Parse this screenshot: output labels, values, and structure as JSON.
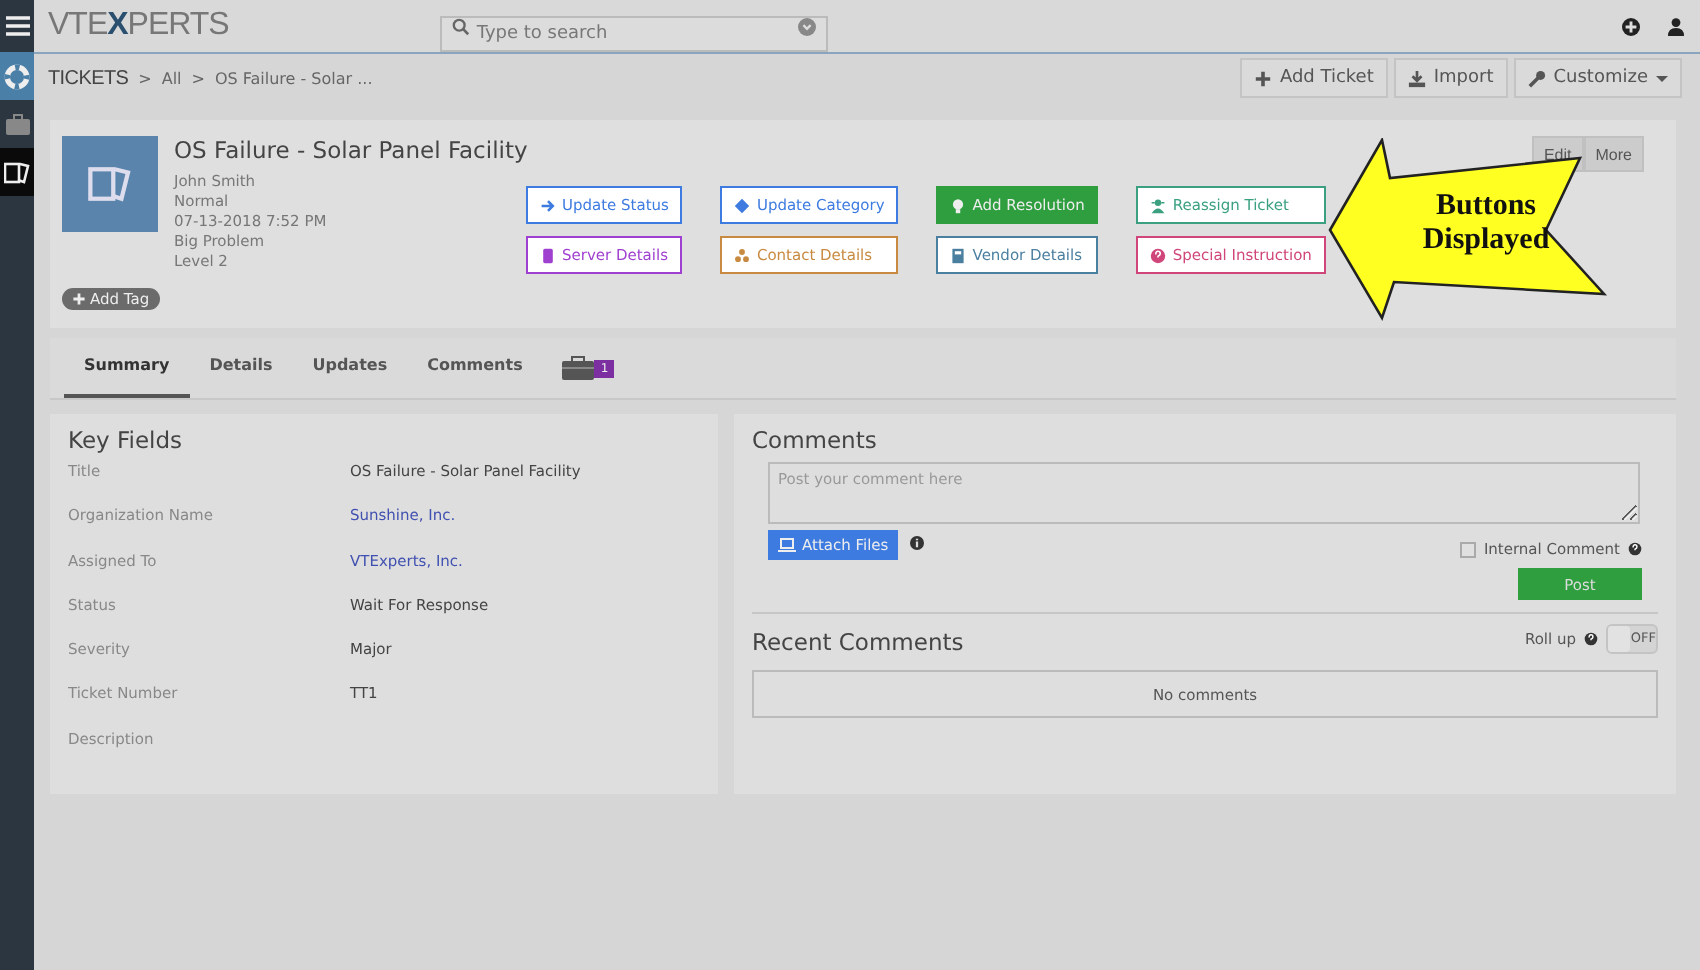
{
  "topbar": {
    "logo": {
      "left": "VTE",
      "mark": "X",
      "right": "PERTS"
    },
    "search": {
      "placeholder": "Type to search"
    }
  },
  "sidebar": {
    "items": [
      {
        "kind": "help"
      },
      {
        "kind": "briefcase"
      },
      {
        "kind": "tickets"
      }
    ]
  },
  "breadcrumb": [
    "TICKETS",
    ">",
    "All",
    ">",
    "OS Failure - Solar ..."
  ],
  "toolbar": [
    {
      "label": "Add Ticket",
      "kind": "plus"
    },
    {
      "label": "Import",
      "kind": "download"
    },
    {
      "label": "Customize",
      "kind": "wrench"
    }
  ],
  "ticket": {
    "title": "OS Failure - Solar Panel Facility",
    "details": [
      "John Smith",
      "Normal",
      "07-13-2018 7:52 PM",
      "Big Problem",
      "Level 2"
    ],
    "add_tag": "Add Tag",
    "actions": [
      "Edit",
      "More"
    ]
  },
  "action_buttons": [
    {
      "label": "Update Status",
      "kind": "arrow",
      "color": "#3d7be0",
      "filled": false
    },
    {
      "label": "Update Category",
      "kind": "diamond",
      "color": "#3d7be0",
      "filled": false
    },
    {
      "label": "Add Resolution",
      "kind": "bulb",
      "color": "#2e9e3e",
      "filled": true
    },
    {
      "label": "Reassign Ticket",
      "kind": "person",
      "color": "#3aa080",
      "filled": false
    },
    {
      "label": "Server Details",
      "kind": "server",
      "color": "#a040d0",
      "filled": false
    },
    {
      "label": "Contact Details",
      "kind": "people",
      "color": "#c88a40",
      "filled": false
    },
    {
      "label": "Vendor Details",
      "kind": "book",
      "color": "#4a7fa0",
      "filled": false
    },
    {
      "label": "Special Instruction",
      "kind": "question",
      "color": "#d0457a",
      "filled": false
    }
  ],
  "callout": {
    "lines": [
      "Buttons",
      "Displayed"
    ]
  },
  "tabs": [
    {
      "label": "Summary",
      "selected": true
    },
    {
      "label": "Details",
      "selected": false
    },
    {
      "label": "Updates",
      "selected": false
    },
    {
      "label": "Comments",
      "selected": false
    }
  ],
  "tab_badge": "1",
  "key_fields": {
    "title": "Key Fields",
    "rows": [
      {
        "label": "Title",
        "value": "OS Failure - Solar Panel Facility",
        "kind": "text"
      },
      {
        "label": "Organization Name",
        "value": "Sunshine, Inc.",
        "kind": "link"
      },
      {
        "label": "Assigned To",
        "value": "VTExperts, Inc.",
        "kind": "link"
      },
      {
        "label": "Status",
        "value": "Wait For Response",
        "kind": "text"
      },
      {
        "label": "Severity",
        "value": "Major",
        "kind": "text"
      },
      {
        "label": "Ticket Number",
        "value": "TT1",
        "kind": "text"
      },
      {
        "label": "Description"
      }
    ]
  },
  "comments": {
    "title": "Comments",
    "placeholder": "Post your comment here",
    "attach": "Attach Files",
    "internal": {
      "label": "Internal Comment",
      "checked": false
    },
    "post": "Post"
  },
  "recent": {
    "title": "Recent Comments",
    "rollup": {
      "label": "Roll up",
      "on": false,
      "state_text": "OFF"
    },
    "empty": "No comments"
  }
}
